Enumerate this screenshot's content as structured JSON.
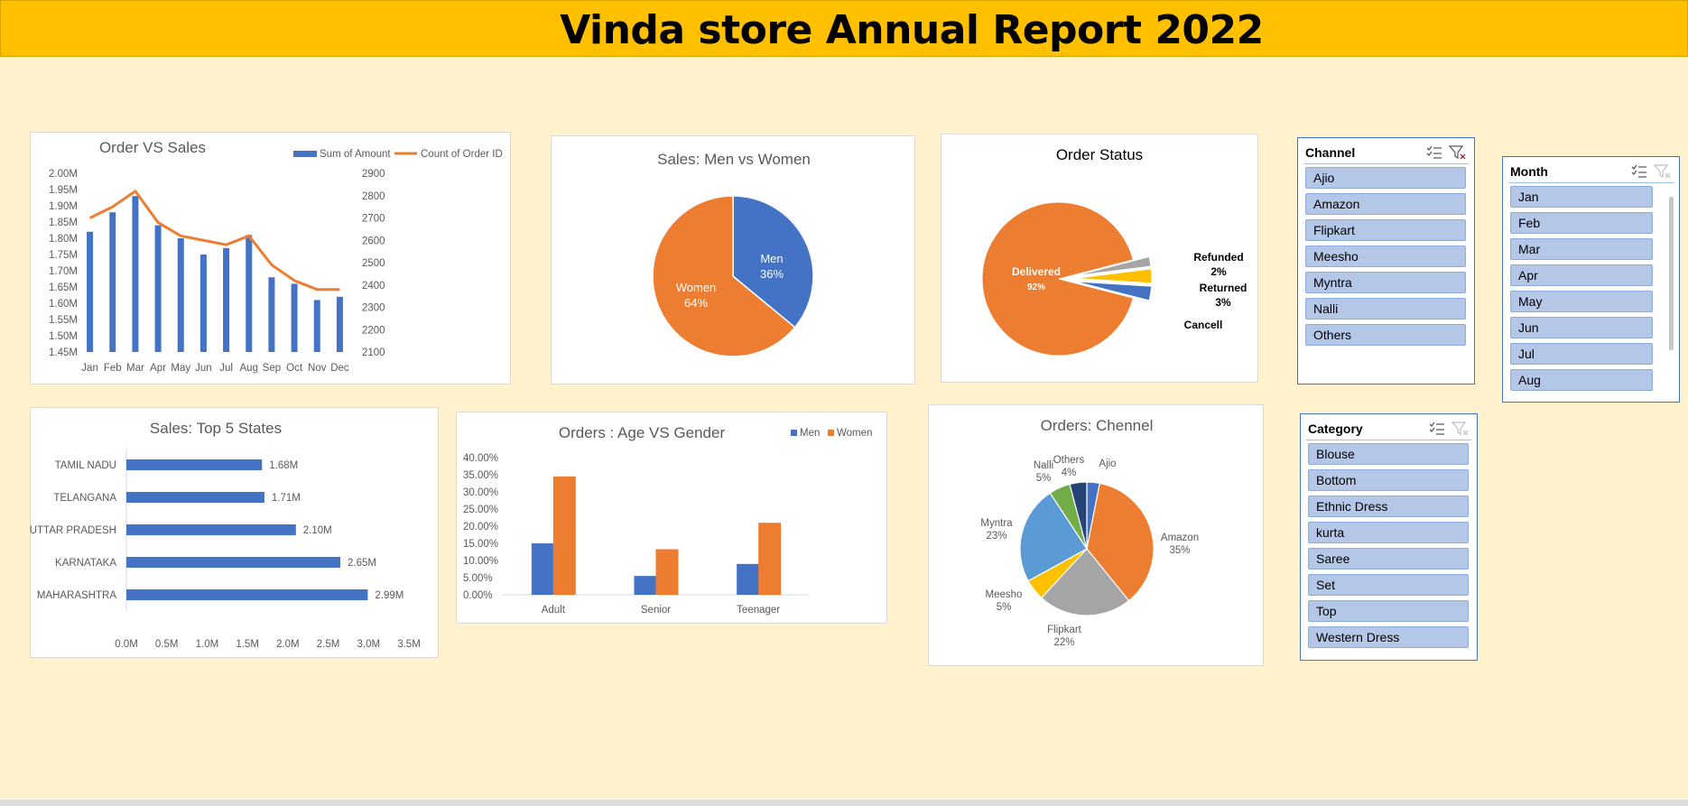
{
  "header": {
    "title": "Vinda store Annual Report 2022"
  },
  "colors": {
    "blue": "#4472c4",
    "orange": "#ed7d31",
    "gray": "#a5a5a5",
    "yellow": "#ffc000",
    "lightblue": "#5b9bd5",
    "green": "#70ad47",
    "navy": "#264478"
  },
  "chart_data": [
    {
      "id": "order_vs_sales",
      "type": "bar",
      "title": "Order VS Sales",
      "categories": [
        "Jan",
        "Feb",
        "Mar",
        "Apr",
        "May",
        "Jun",
        "Jul",
        "Aug",
        "Sep",
        "Oct",
        "Nov",
        "Dec"
      ],
      "series": [
        {
          "name": "Sum of Amount",
          "type": "bar",
          "axis": "left",
          "values": [
            1.82,
            1.88,
            1.93,
            1.84,
            1.8,
            1.75,
            1.77,
            1.81,
            1.68,
            1.66,
            1.61,
            1.62
          ]
        },
        {
          "name": "Count of Order ID",
          "type": "line",
          "axis": "right",
          "values": [
            2700,
            2750,
            2820,
            2680,
            2620,
            2600,
            2580,
            2620,
            2490,
            2420,
            2380,
            2380
          ]
        }
      ],
      "y_left_ticks": [
        "2.00M",
        "1.95M",
        "1.90M",
        "1.85M",
        "1.80M",
        "1.75M",
        "1.70M",
        "1.65M",
        "1.60M",
        "1.55M",
        "1.50M",
        "1.45M"
      ],
      "y_right_ticks": [
        "2900",
        "2800",
        "2700",
        "2600",
        "2500",
        "2400",
        "2300",
        "2200",
        "2100"
      ],
      "ylim_left": [
        1.45,
        2.0
      ],
      "ylim_right": [
        2100,
        2900
      ],
      "legend": "top-right"
    },
    {
      "id": "men_vs_women",
      "type": "pie",
      "title": "Sales: Men vs Women",
      "slices": [
        {
          "label": "Men",
          "value": 36,
          "pct": "36%"
        },
        {
          "label": "Women",
          "value": 64,
          "pct": "64%"
        }
      ]
    },
    {
      "id": "order_status",
      "type": "pie",
      "title": "Order Status",
      "slices": [
        {
          "label": "Delivered",
          "value": 92,
          "pct": "92%"
        },
        {
          "label": "Cancell",
          "value": 3,
          "pct": ""
        },
        {
          "label": "Returned",
          "value": 3,
          "pct": "3%"
        },
        {
          "label": "Refunded",
          "value": 2,
          "pct": "2%"
        }
      ]
    },
    {
      "id": "top5_states",
      "type": "bar",
      "orientation": "horizontal",
      "title": "Sales: Top 5 States",
      "categories": [
        "TAMIL NADU",
        "TELANGANA",
        "UTTAR PRADESH",
        "KARNATAKA",
        "MAHARASHTRA"
      ],
      "values": [
        1.68,
        1.71,
        2.1,
        2.65,
        2.99
      ],
      "labels": [
        "1.68M",
        "1.71M",
        "2.10M",
        "2.65M",
        "2.99M"
      ],
      "x_ticks": [
        "0.0M",
        "0.5M",
        "1.0M",
        "1.5M",
        "2.0M",
        "2.5M",
        "3.0M",
        "3.5M"
      ],
      "xlim": [
        0,
        3.5
      ]
    },
    {
      "id": "age_vs_gender",
      "type": "bar",
      "title": "Orders : Age VS Gender",
      "categories": [
        "Adult",
        "Senior",
        "Teenager"
      ],
      "series": [
        {
          "name": "Men",
          "values": [
            15.0,
            5.5,
            9.0
          ]
        },
        {
          "name": "Women",
          "values": [
            34.5,
            13.3,
            21.0
          ]
        }
      ],
      "y_ticks": [
        "40.00%",
        "35.00%",
        "30.00%",
        "25.00%",
        "20.00%",
        "15.00%",
        "10.00%",
        "5.00%",
        "0.00%"
      ],
      "ylim": [
        0,
        40
      ],
      "legend": "top-right"
    },
    {
      "id": "orders_channel",
      "type": "pie",
      "title": "Orders: Chennel",
      "slices": [
        {
          "label": "Ajio",
          "value": 3,
          "pct": ""
        },
        {
          "label": "Amazon",
          "value": 35,
          "pct": "35%"
        },
        {
          "label": "Flipkart",
          "value": 22,
          "pct": "22%"
        },
        {
          "label": "Meesho",
          "value": 5,
          "pct": "5%"
        },
        {
          "label": "Myntra",
          "value": 23,
          "pct": "23%"
        },
        {
          "label": "Nalli",
          "value": 5,
          "pct": "5%"
        },
        {
          "label": "Others",
          "value": 4,
          "pct": "4%"
        }
      ]
    }
  ],
  "slicers": {
    "channel": {
      "title": "Channel",
      "items": [
        "Ajio",
        "Amazon",
        "Flipkart",
        "Meesho",
        "Myntra",
        "Nalli",
        "Others"
      ]
    },
    "month": {
      "title": "Month",
      "items": [
        "Jan",
        "Feb",
        "Mar",
        "Apr",
        "May",
        "Jun",
        "Jul",
        "Aug"
      ]
    },
    "category": {
      "title": "Category",
      "items": [
        "Blouse",
        "Bottom",
        "Ethnic Dress",
        "kurta",
        "Saree",
        "Set",
        "Top",
        "Western Dress"
      ]
    }
  }
}
